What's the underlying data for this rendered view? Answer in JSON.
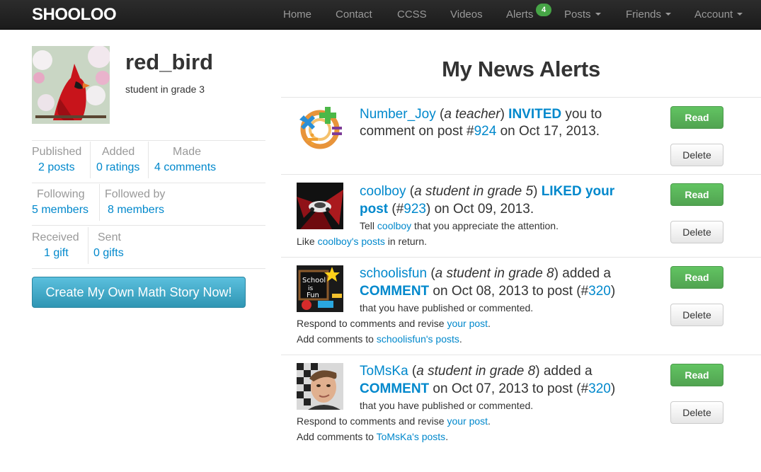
{
  "navbar": {
    "brand": "SHOOLOO",
    "items": [
      "Home",
      "Contact",
      "CCSS",
      "Videos",
      "Alerts",
      "Posts",
      "Friends",
      "Account"
    ],
    "alerts_badge": "4"
  },
  "profile": {
    "username": "red_bird",
    "subtitle": "student in grade 3",
    "stats": {
      "published_label": "Published",
      "published_value": "2 posts",
      "added_label": "Added",
      "added_value": "0 ratings",
      "made_label": "Made",
      "made_value": "4 comments",
      "following_label": "Following",
      "following_value": "5 members",
      "followed_label": "Followed by",
      "followed_value": "8 members",
      "received_label": "Received",
      "received_value": "1 gift",
      "sent_label": "Sent",
      "sent_value": "0 gifts"
    },
    "cta_label": "Create My Own Math Story Now!"
  },
  "alerts": {
    "title": "My News Alerts",
    "read_label": "Read",
    "delete_label": "Delete",
    "items": [
      {
        "user": "Number_Joy",
        "role": "a teacher",
        "action": "INVITED",
        "t1": " you to",
        "t2": "comment on post #",
        "post": "924",
        "t3": " on Oct 17, 2013."
      },
      {
        "user": "coolboy",
        "role": "a student in grade 5",
        "action": "LIKED your",
        "action2": "post",
        "t2": " (#",
        "post": "923",
        "t3": ") on Oct 09, 2013.",
        "tell_pre": "Tell ",
        "tell_user": "coolboy",
        "tell_post": " that you appreciate the attention.",
        "like_pre": "Like ",
        "like_link": "coolboy's posts",
        "like_post": " in return."
      },
      {
        "user": "schoolisfun",
        "role": "a student in grade 8",
        "t1": " added a",
        "action": "COMMENT",
        "t2": " on Oct 08, 2013 to post (#",
        "post": "320",
        "t3": ")",
        "s1": "that you have published or commented.",
        "s2_pre": "Respond to comments and revise ",
        "s2_link": "your post",
        "s2_post": ".",
        "s3_pre": "Add comments to ",
        "s3_link": "schoolisfun's posts",
        "s3_post": "."
      },
      {
        "user": "ToMsKa",
        "role": "a student in grade 8",
        "t1": " added a",
        "action": "COMMENT",
        "t2": " on Oct 07, 2013 to post (#",
        "post": "320",
        "t3": ")",
        "s1": "that you have published or commented.",
        "s2_pre": "Respond to comments and revise ",
        "s2_link": "your post",
        "s2_post": ".",
        "s3_pre": "Add comments to ",
        "s3_link": "ToMsKa's posts",
        "s3_post": "."
      }
    ]
  },
  "colors": {
    "link": "#0088cc",
    "read_button": "#5bb75b",
    "cta": "#49afcd",
    "navbar": "#222222"
  },
  "icons": [
    "cardinal-avatar",
    "math-symbols-avatar",
    "sports-car-avatar",
    "school-is-fun-avatar",
    "boy-photo-avatar"
  ]
}
